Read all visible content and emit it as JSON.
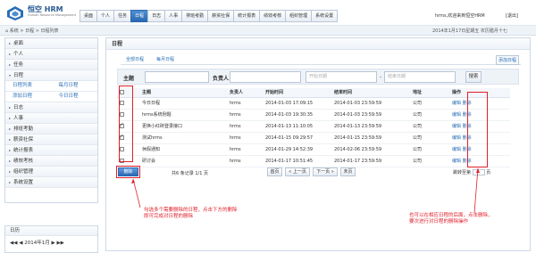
{
  "app": {
    "brand": "恒空 HRM",
    "brand_sub": "Human Resource Management",
    "welcome": "hrms,欢迎来到恒空HRM",
    "logout": "[退出]"
  },
  "nav": [
    "桌面",
    "个人",
    "任务",
    "日程",
    "日志",
    "人事",
    "排班考勤",
    "薪资社保",
    "统计报表",
    "绩效考核",
    "组织管理",
    "系统设置"
  ],
  "nav_active_index": 3,
  "breadcrumb": "系统 > 日程 > 日程列表",
  "date": "2014年1月17日星期五 农历腊月十七",
  "sidebar": {
    "items": [
      {
        "label": "桌面",
        "arrow": "▸"
      },
      {
        "label": "个人",
        "arrow": "▸"
      },
      {
        "label": "任务",
        "arrow": "▸"
      },
      {
        "label": "日程",
        "arrow": "▾"
      },
      {
        "label": "日志",
        "arrow": "▸"
      },
      {
        "label": "人事",
        "arrow": "▸"
      },
      {
        "label": "排班考勤",
        "arrow": "▸"
      },
      {
        "label": "薪资社保",
        "arrow": "▸"
      },
      {
        "label": "统计报表",
        "arrow": "▸"
      },
      {
        "label": "绩效考核",
        "arrow": "▸"
      },
      {
        "label": "组织管理",
        "arrow": "▸"
      },
      {
        "label": "系统设置",
        "arrow": "▸"
      }
    ],
    "sub_schedule": [
      [
        "日程列表",
        "每月日程"
      ],
      [
        "添加日程",
        "今日日程"
      ]
    ]
  },
  "calendar": {
    "title": "日历",
    "prev_year": "◀◀",
    "prev_month": "◀",
    "month": "2014年1月",
    "next_month": "▶",
    "next_year": "▶▶"
  },
  "main": {
    "title": "日程",
    "tabs": [
      "全部日程",
      "每月日程"
    ],
    "add_link": "添加日程",
    "filter": {
      "subject_label": "主题",
      "owner_label": "负责人",
      "start_placeholder": "开始日期",
      "end_placeholder": "结束日期",
      "search_button": "搜索"
    },
    "columns": [
      "主题",
      "负责人",
      "开始时间",
      "结束时间",
      "地址",
      "操作"
    ],
    "rows": [
      {
        "checked": false,
        "subject": "今日日程",
        "owner": "hrms",
        "start": "2014-01-03 17:09:15",
        "end": "2014-01-03 23:59:59",
        "addr": "公司",
        "edit": "编辑",
        "del": "删除"
      },
      {
        "checked": false,
        "subject": "hrms系统例题",
        "owner": "hrms",
        "start": "2014-01-03 19:30:35",
        "end": "2014-01-03 23:59:59",
        "addr": "公司",
        "edit": "编辑",
        "del": "删除"
      },
      {
        "checked": true,
        "subject": "更换小红砖登录接口",
        "owner": "hrms",
        "start": "2014-01-13 11:10:05",
        "end": "2014-01-13 23:59:59",
        "addr": "公司",
        "edit": "编辑",
        "del": "删除"
      },
      {
        "checked": true,
        "subject": "测试hrms",
        "owner": "hrms",
        "start": "2014-01-15 09:29:57",
        "end": "2014-01-15 23:59:59",
        "addr": "公司",
        "edit": "编辑",
        "del": "删除"
      },
      {
        "checked": false,
        "subject": "休假通知",
        "owner": "hrms",
        "start": "2014-01-29 14:52:39",
        "end": "2014-02-06 23:59:59",
        "addr": "公司",
        "edit": "编辑",
        "del": "删除"
      },
      {
        "checked": false,
        "subject": "研讨会",
        "owner": "hrms",
        "start": "2014-01-17 10:51:45",
        "end": "2014-01-17 23:59:59",
        "addr": "公司",
        "edit": "编辑",
        "del": "删除"
      }
    ],
    "delete_button": "删除",
    "pager": {
      "info": "共6 条记录 1/1 页",
      "first": "首页",
      "prev": "« 上一页",
      "next": "下一页 »",
      "last": "末页",
      "jump_label": "跳转至第",
      "jump_suffix": "页"
    }
  },
  "annotations": {
    "left_note_1": "勾选多个需要删除的日程，点击下方的删除",
    "left_note_2": "即可完成对日程的删除",
    "right_note_1": "也可以在相应日程的后面，点击删除，",
    "right_note_2": "要次进行对日程的删除操作"
  },
  "colors": {
    "accent": "#2a69b0",
    "link": "#2b6fb6",
    "annotation": "#e0202a"
  }
}
